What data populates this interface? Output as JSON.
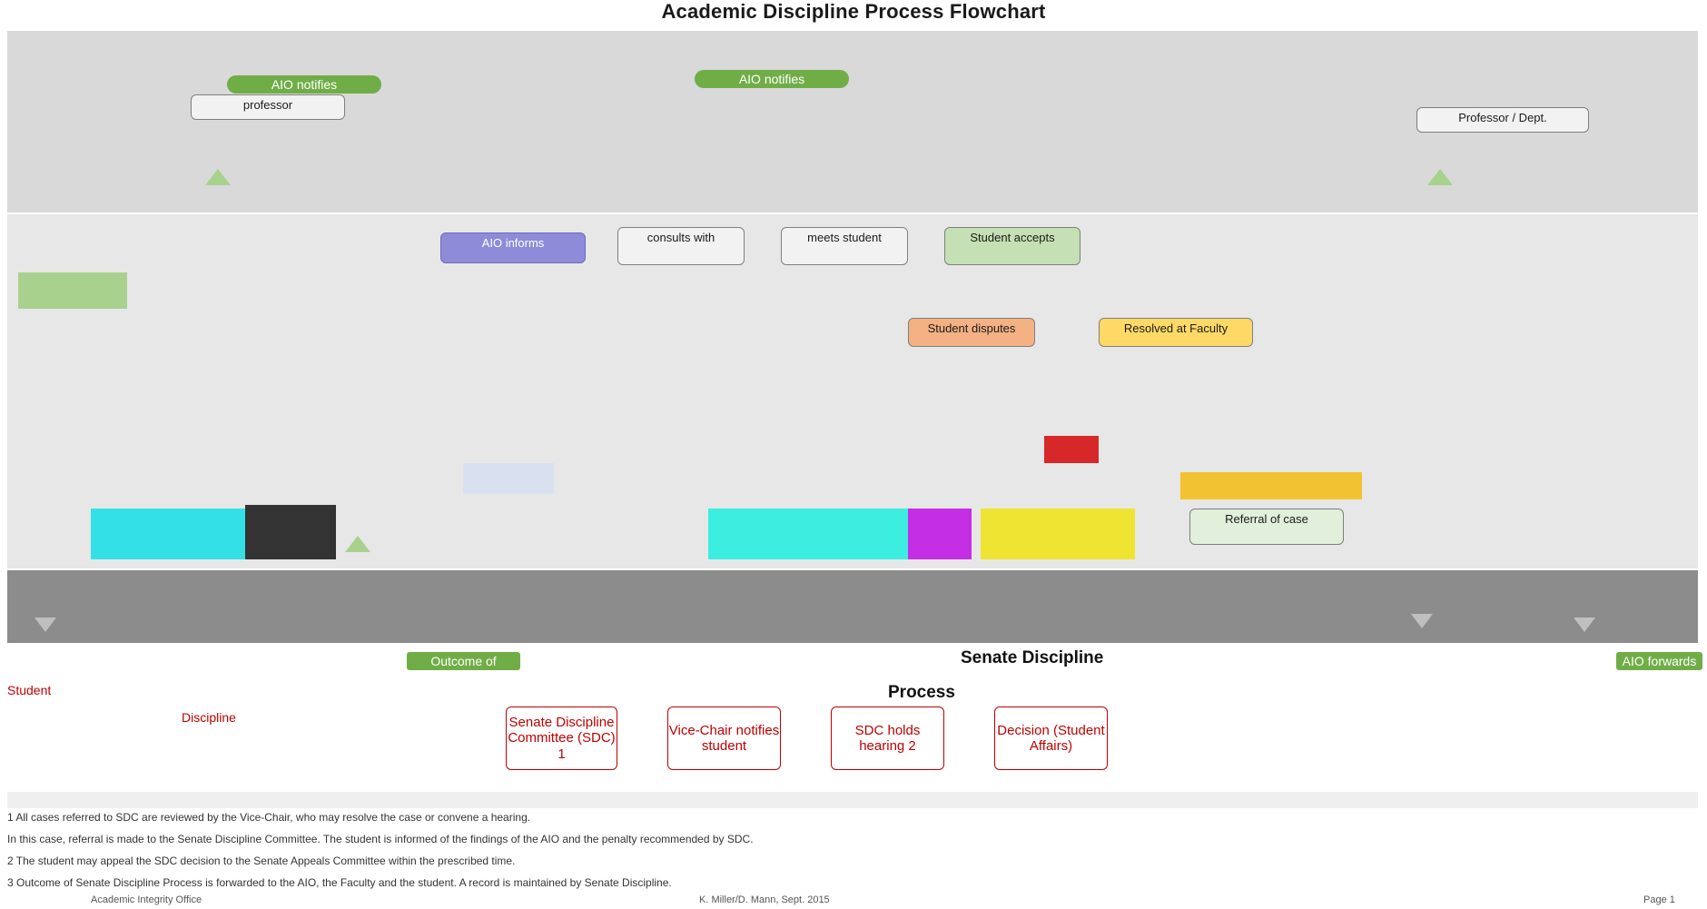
{
  "title": "Academic Discipline Process Flowchart",
  "top_labels": {
    "aio_notifies_left": "AIO notifies",
    "aio_notifies_mid": "AIO notifies",
    "professor_left": "professor",
    "professor_right": "Professor / Dept."
  },
  "middle_boxes": [
    "AIO informs",
    "consults with",
    "meets student",
    "Student accepts",
    "Student disputes",
    "Resolved at Faculty",
    "Referral of case"
  ],
  "senate_section": {
    "heading": "Senate Discipline",
    "subheading": "Process",
    "outcome_label": "Outcome of",
    "aio_forward_label": "AIO forwards",
    "student_label": "Student",
    "discipline_label": "Discipline",
    "steps": [
      "Senate Discipline Committee (SDC) 1",
      "Vice-Chair notifies student",
      "SDC holds hearing 2",
      "Decision (Student Affairs)"
    ]
  },
  "footnotes": [
    "1 All cases referred to SDC are reviewed by the Vice-Chair, who may resolve the case or convene a hearing.",
    "In this case, referral is made to the Senate Discipline Committee. The student is informed of the findings of the AIO and the penalty recommended by SDC.",
    "2 The student may appeal the SDC decision to the Senate Appeals Committee within the prescribed time.",
    "3 Outcome of Senate Discipline Process is forwarded to the AIO, the Faculty and the student. A record is maintained by Senate Discipline."
  ],
  "footer": {
    "left": "Academic Integrity Office",
    "center": "K. Miller/D. Mann, Sept. 2015",
    "right": "Page 1"
  },
  "colors": {
    "accent_green": "#70ad47",
    "process_red": "#c00000",
    "band_grey": "#d9d9d9"
  }
}
